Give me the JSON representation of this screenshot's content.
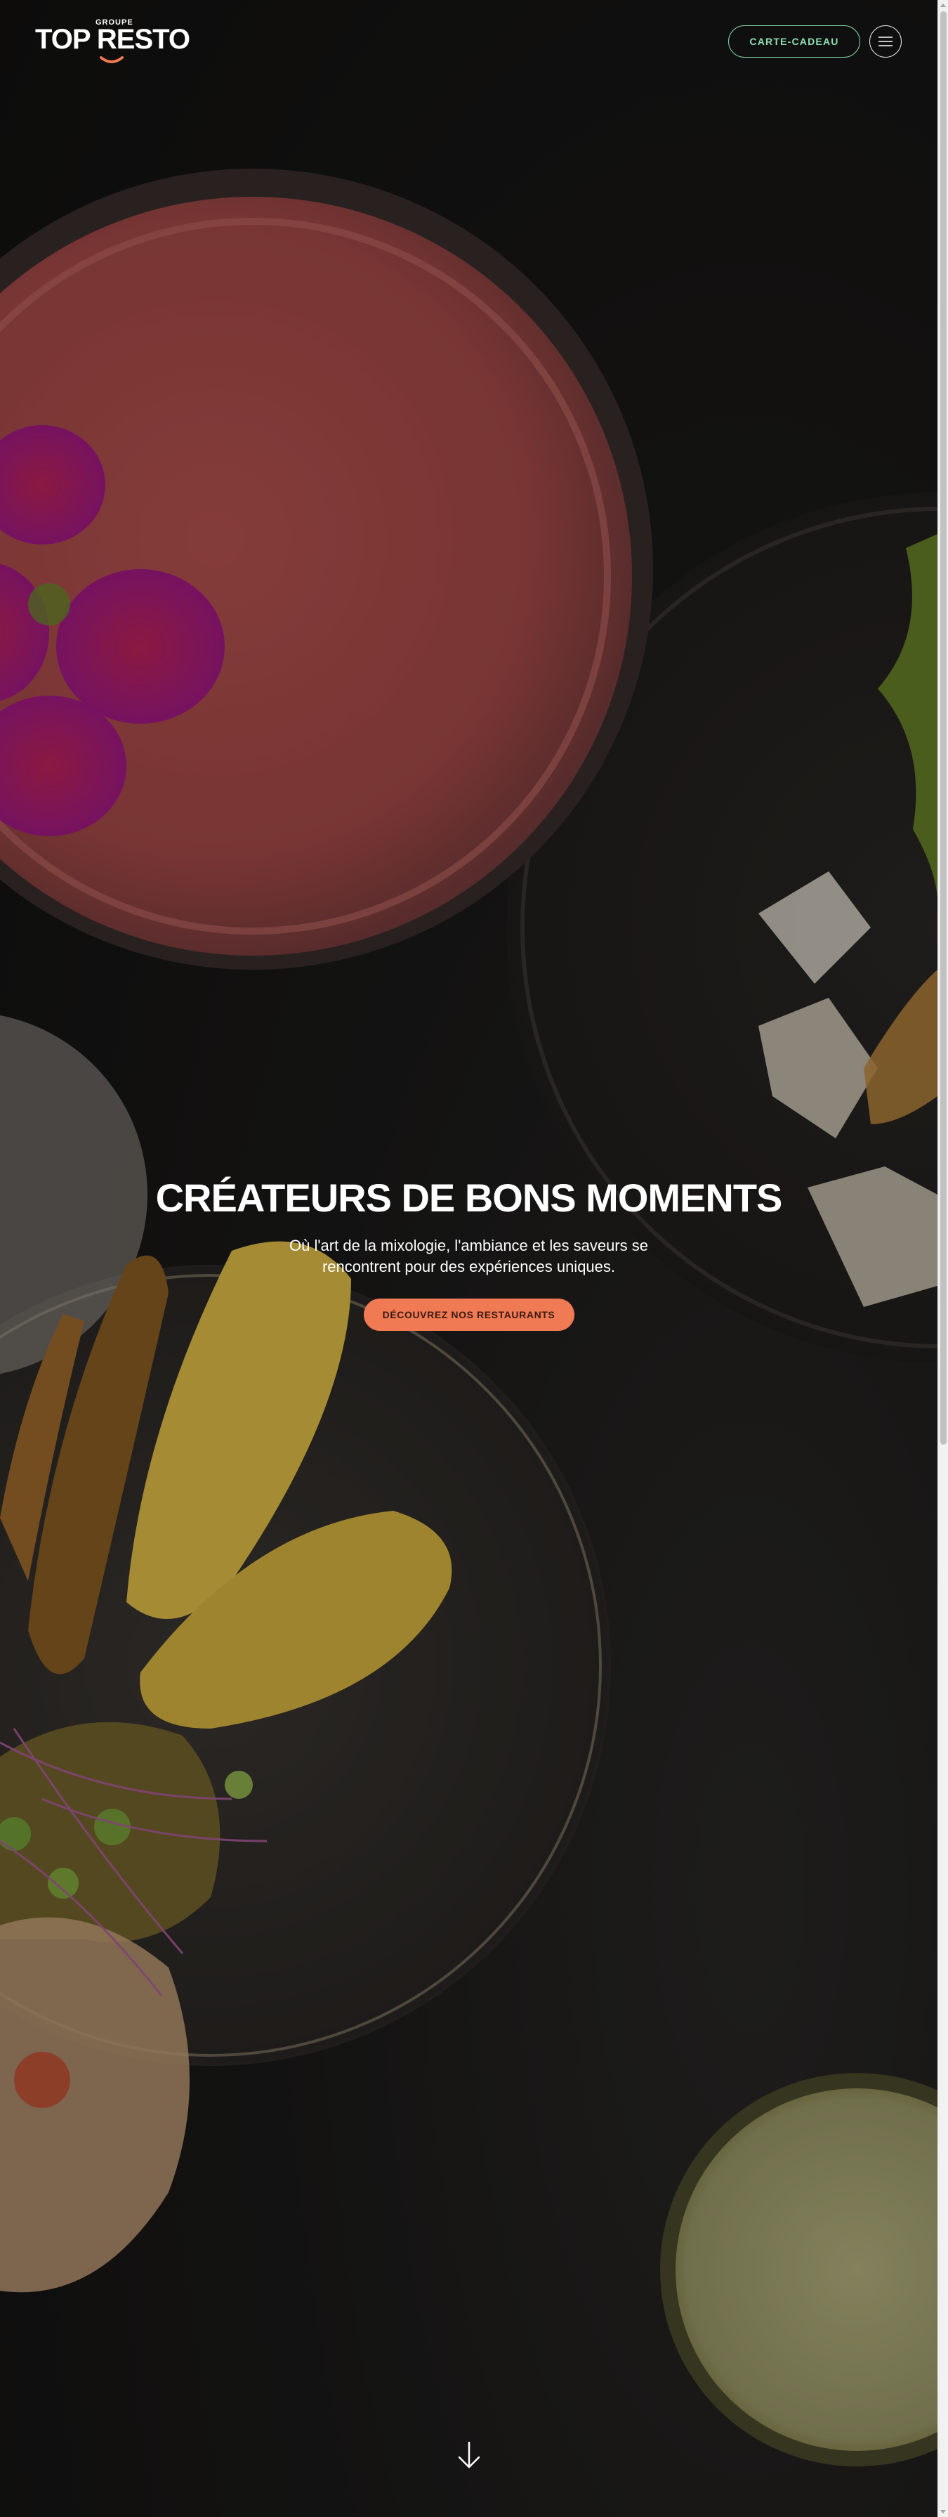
{
  "brand": {
    "prefix": "GROUPE",
    "name": "TOP RESTO",
    "accent_color": "#f07a53"
  },
  "header": {
    "gift_card_label": "CARTE-CADEAU",
    "gift_card_color": "#7fd3a3",
    "menu_icon": "hamburger-menu-icon"
  },
  "hero": {
    "title": "CRÉATEURS DE BONS MOMENTS",
    "text": "Où l'art de la mixologie, l'ambiance et les saveurs se rencontrent pour des expériences uniques.",
    "cta_label": "DÉCOUVREZ NOS RESTAURANTS",
    "scroll_icon": "arrow-down-icon"
  }
}
